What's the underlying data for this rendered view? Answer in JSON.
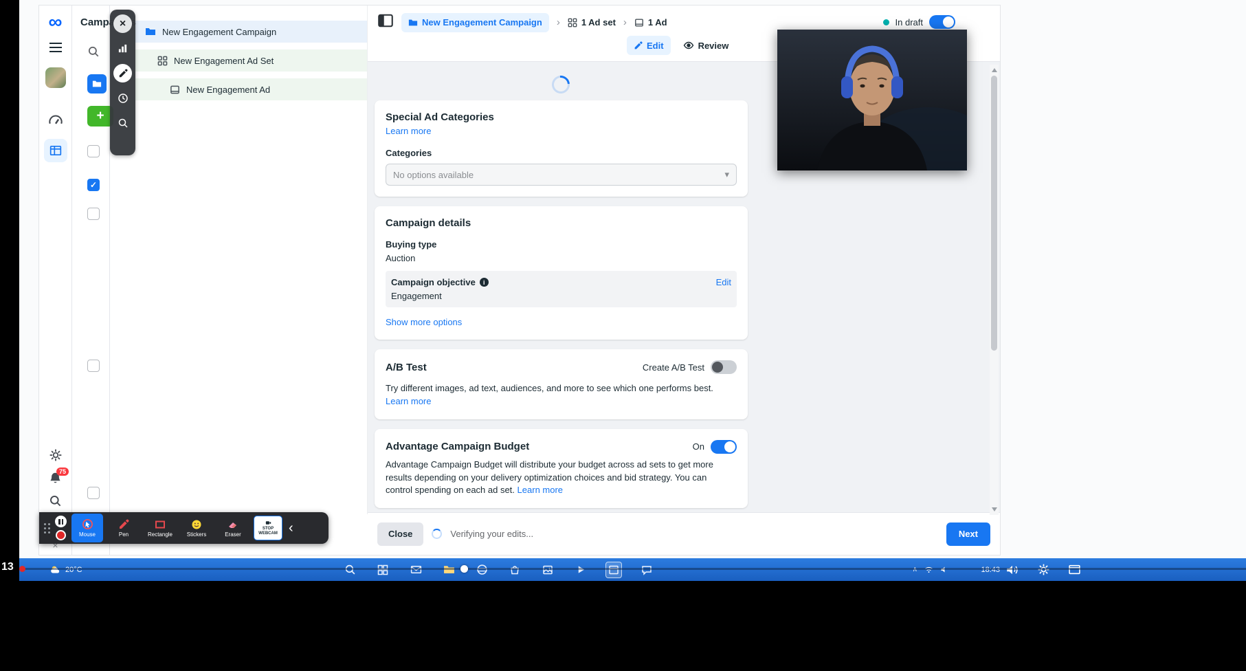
{
  "icons": {
    "meta_logo": "∞",
    "plus": "+",
    "check": "✓",
    "close": "×",
    "question": "?",
    "info": "i",
    "crumb_sep": "›",
    "caret_down": "▾",
    "collapse_left": "‹",
    "tray_caret": "∧",
    "cut_icon": "×"
  },
  "colors": {
    "accent": "#1877f2",
    "link": "#1877f2",
    "draft_dot": "#00b0ae",
    "add_green": "#42b72a",
    "record_red": "#e02828",
    "taskbar_blue": "#1e6fd0"
  },
  "rail": {
    "notifications_badge": "75"
  },
  "campaigns_panel": {
    "title": "Campaigns"
  },
  "tree": {
    "items": [
      {
        "label": "New Engagement Campaign"
      },
      {
        "label": "New Engagement Ad Set"
      },
      {
        "label": "New Engagement Ad"
      }
    ]
  },
  "header": {
    "breadcrumb": [
      {
        "label": "New Engagement Campaign"
      },
      {
        "label": "1 Ad set"
      },
      {
        "label": "1 Ad"
      }
    ],
    "status_label": "In draft",
    "tabs": {
      "edit": "Edit",
      "review": "Review"
    }
  },
  "cards": {
    "special_ad": {
      "title": "Special Ad Categories",
      "learn_more": "Learn more",
      "categories_label": "Categories",
      "select_value": "No options available"
    },
    "campaign_details": {
      "title": "Campaign details",
      "buying_type_label": "Buying type",
      "buying_type_value": "Auction",
      "objective_label": "Campaign objective",
      "objective_value": "Engagement",
      "edit_link": "Edit",
      "show_more": "Show more options"
    },
    "ab_test": {
      "title": "A/B Test",
      "create_label": "Create A/B Test",
      "description": "Try different images, ad text, audiences, and more to see which one performs best.",
      "learn_more": "Learn more"
    },
    "budget": {
      "title": "Advantage Campaign Budget",
      "state_label": "On",
      "description": "Advantage Campaign Budget will distribute your budget across ad sets to get more results depending on your delivery optimization choices and bid strategy. You can control spending on each ad set.",
      "learn_more": "Learn more"
    }
  },
  "footer": {
    "close": "Close",
    "status": "Verifying your edits...",
    "next": "Next"
  },
  "recorder": {
    "tools": [
      {
        "label": "Mouse"
      },
      {
        "label": "Pen"
      },
      {
        "label": "Rectangle"
      },
      {
        "label": "Stickers"
      },
      {
        "label": "Eraser"
      }
    ],
    "stop_webcam": "STOP WEBCAM"
  },
  "taskbar": {
    "temperature": "20°C",
    "time": "18:43"
  },
  "player": {
    "timestamp": "13"
  }
}
